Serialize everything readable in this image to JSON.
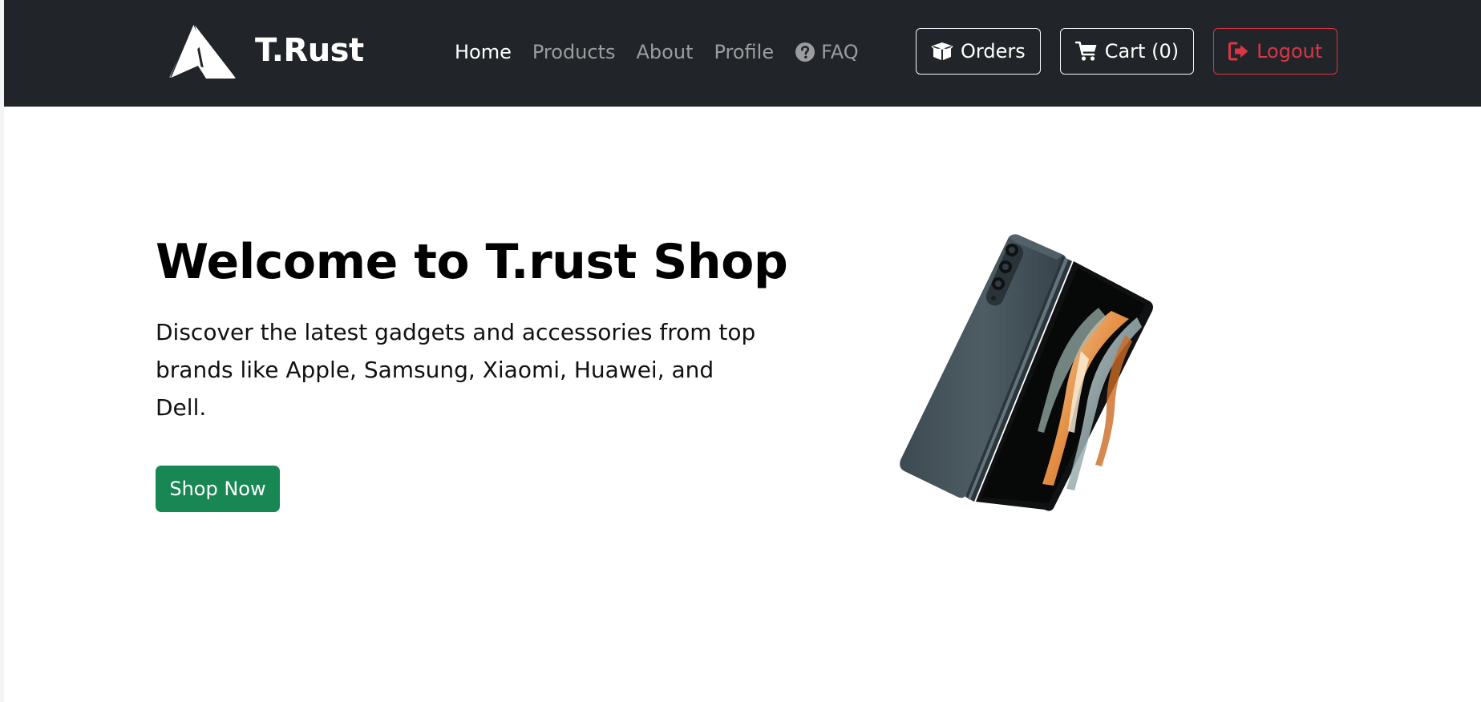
{
  "navbar": {
    "brand": {
      "name": "T.Rust",
      "logo_icon": "mountain-triangle-logo"
    },
    "links": [
      {
        "label": "Home",
        "active": true
      },
      {
        "label": "Products",
        "active": false
      },
      {
        "label": "About",
        "active": false
      },
      {
        "label": "Profile",
        "active": false
      },
      {
        "label": "FAQ",
        "active": false,
        "icon": "question-circle-icon"
      }
    ],
    "actions": {
      "orders": {
        "label": "Orders",
        "icon": "box-icon"
      },
      "cart": {
        "label": "Cart (0)",
        "icon": "cart-icon"
      },
      "logout": {
        "label": "Logout",
        "icon": "sign-out-icon"
      }
    },
    "colors": {
      "background": "#212529",
      "link_inactive": "rgba(255,255,255,0.55)",
      "link_active": "#ffffff",
      "danger": "#dc3545"
    }
  },
  "hero": {
    "title": "Welcome to T.rust Shop",
    "description": "Discover the latest gadgets and accessories from top brands like Apple, Samsung, Xiaomi, Huawei, and Dell.",
    "cta_label": "Shop Now",
    "cta_color": "#198754",
    "image": "foldable-phone-image"
  }
}
